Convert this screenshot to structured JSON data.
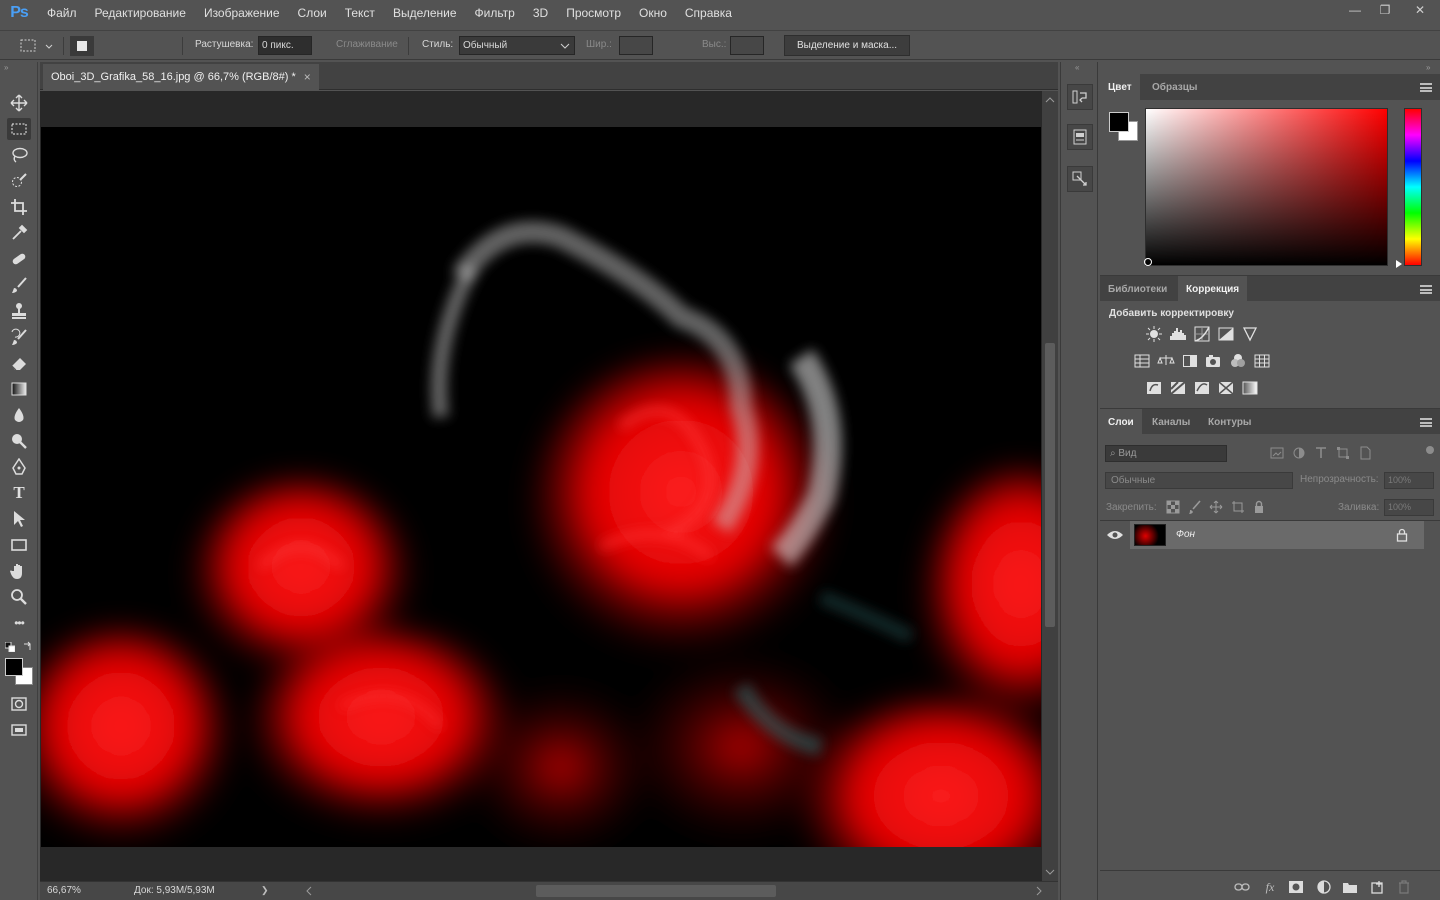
{
  "app": {
    "logo": "Ps",
    "accent": "#31a8ff"
  },
  "menu": [
    "Файл",
    "Редактирование",
    "Изображение",
    "Слои",
    "Текст",
    "Выделение",
    "Фильтр",
    "3D",
    "Просмотр",
    "Окно",
    "Справка"
  ],
  "window_controls": {
    "minimize": "—",
    "restore": "❐",
    "close": "✕"
  },
  "options": {
    "feather_label": "Растушевка:",
    "feather_value": "0 пикс.",
    "antialias_label": "Сглаживание",
    "style_label": "Стиль:",
    "style_value": "Обычный",
    "width_label": "Шир.:",
    "height_label": "Выс.:",
    "mask_button": "Выделение и маска..."
  },
  "document": {
    "tab_title": "Oboi_3D_Grafika_58_16.jpg @ 66,7% (RGB/8#) *",
    "close": "×",
    "zoom": "66,67%",
    "doc_info": "Док: 5,93M/5,93M",
    "info_arrow": "❯"
  },
  "panels": {
    "color": {
      "tabs": [
        "Цвет",
        "Образцы"
      ],
      "fg": "#000000",
      "bg": "#ffffff",
      "hue": "#ff0000"
    },
    "adjustments": {
      "tabs": [
        "Библиотеки",
        "Коррекция"
      ],
      "heading": "Добавить корректировку"
    },
    "layers": {
      "tabs": [
        "Слои",
        "Каналы",
        "Контуры"
      ],
      "filter_placeholder": "Вид",
      "blend_mode": "Обычные",
      "opacity_label": "Непрозрачность:",
      "opacity_value": "100%",
      "lock_label": "Закрепить:",
      "fill_label": "Заливка:",
      "fill_value": "100%",
      "layer_name": "Фон"
    }
  },
  "icons": {
    "tools": [
      "move-icon",
      "marquee-icon",
      "lasso-icon",
      "quick-select-icon",
      "crop-icon",
      "eyedropper-icon",
      "healing-brush-icon",
      "brush-icon",
      "clone-stamp-icon",
      "history-brush-icon",
      "eraser-icon",
      "gradient-icon",
      "blur-icon",
      "dodge-icon",
      "pen-icon",
      "type-icon",
      "path-select-icon",
      "rectangle-icon",
      "hand-icon",
      "zoom-icon",
      "more-tools-icon"
    ],
    "type_glyph": "T",
    "more_glyph": "•••",
    "search_glyph": "⌕",
    "layer_bottom": [
      "link-icon",
      "fx-icon",
      "mask-icon",
      "adjustment-icon",
      "folder-icon",
      "new-layer-icon",
      "trash-icon"
    ],
    "fx_glyph": "fx"
  }
}
